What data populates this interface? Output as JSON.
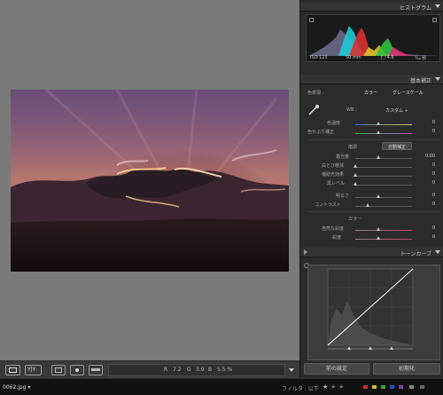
{
  "histogram_panel": {
    "title": "ヒストグラム",
    "iso": "ISO 125",
    "focal": "50 mm",
    "aperture": "ƒ / 4.8",
    "shutter": "¹⁄₃₀ 秒"
  },
  "basic_panel": {
    "title": "基本補正",
    "treatment_label": "色表現 :",
    "color_option": "カラー",
    "grayscale_option": "グレースケール",
    "wb_label": "WB :",
    "wb_value": "カスタム ÷",
    "temp_label": "色温度",
    "temp_value": "0",
    "tint_label": "色かぶり補正",
    "tint_value": "0",
    "tone_label": "階調",
    "auto_button": "自動補正",
    "exposure_label": "露光量",
    "exposure_value": "0.00",
    "highlights_label": "白とび軽減",
    "highlights_value": "0",
    "fill_label": "補助光効果",
    "fill_value": "0",
    "blacks_label": "黒レベル",
    "blacks_value": "0",
    "brightness_label": "明るさ",
    "brightness_value": "0",
    "contrast_label": "コントラスト",
    "contrast_value": "0",
    "presence_label": "カラー",
    "vibrance_label": "自然な彩度",
    "vibrance_value": "0",
    "saturation_label": "彩度",
    "saturation_value": "0"
  },
  "tone_curve_panel": {
    "title": "トーンカーブ"
  },
  "buttons": {
    "previous": "前の設定",
    "reset": "初期化"
  },
  "toolbar": {
    "r_label": "R",
    "r_value": "7.2",
    "g_label": "G",
    "g_value": "3.9",
    "b_label": "B",
    "b_value": "5.5 %"
  },
  "status": {
    "filename": "0062.jpg ▾",
    "filter_label": "フィルタ : 以下"
  },
  "colors": {
    "panel_bg": "#2b2b2b",
    "view_bg": "#7a7a7a",
    "sky_top": "#6a4e79",
    "sun_glow": "#f0a050"
  }
}
